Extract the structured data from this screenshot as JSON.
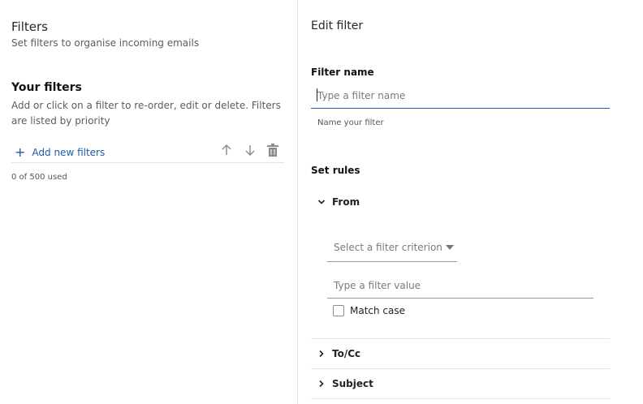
{
  "left": {
    "title": "Filters",
    "subtitle": "Set filters to organise incoming emails",
    "your_filters": {
      "heading": "Your filters",
      "desc_line1": "Add or click on a filter to re-order, edit or delete. Filters",
      "desc_line2": "are listed by priority"
    },
    "add_label": "Add new filters",
    "add_icon": "+",
    "count": "0 of 500 used"
  },
  "right": {
    "title": "Edit filter",
    "filter_name": {
      "label": "Filter name",
      "placeholder": "Type a filter name",
      "helper": "Name your filter"
    },
    "set_rules": {
      "heading": "Set rules",
      "from": {
        "label": "From",
        "criterion_placeholder": "Select a filter criterion",
        "value_placeholder": "Type a filter value",
        "match_case": "Match case"
      },
      "to_cc": "To/Cc",
      "subject": "Subject"
    }
  },
  "colors": {
    "accent": "#1f5ba8",
    "divider": "#e3e3e3"
  }
}
